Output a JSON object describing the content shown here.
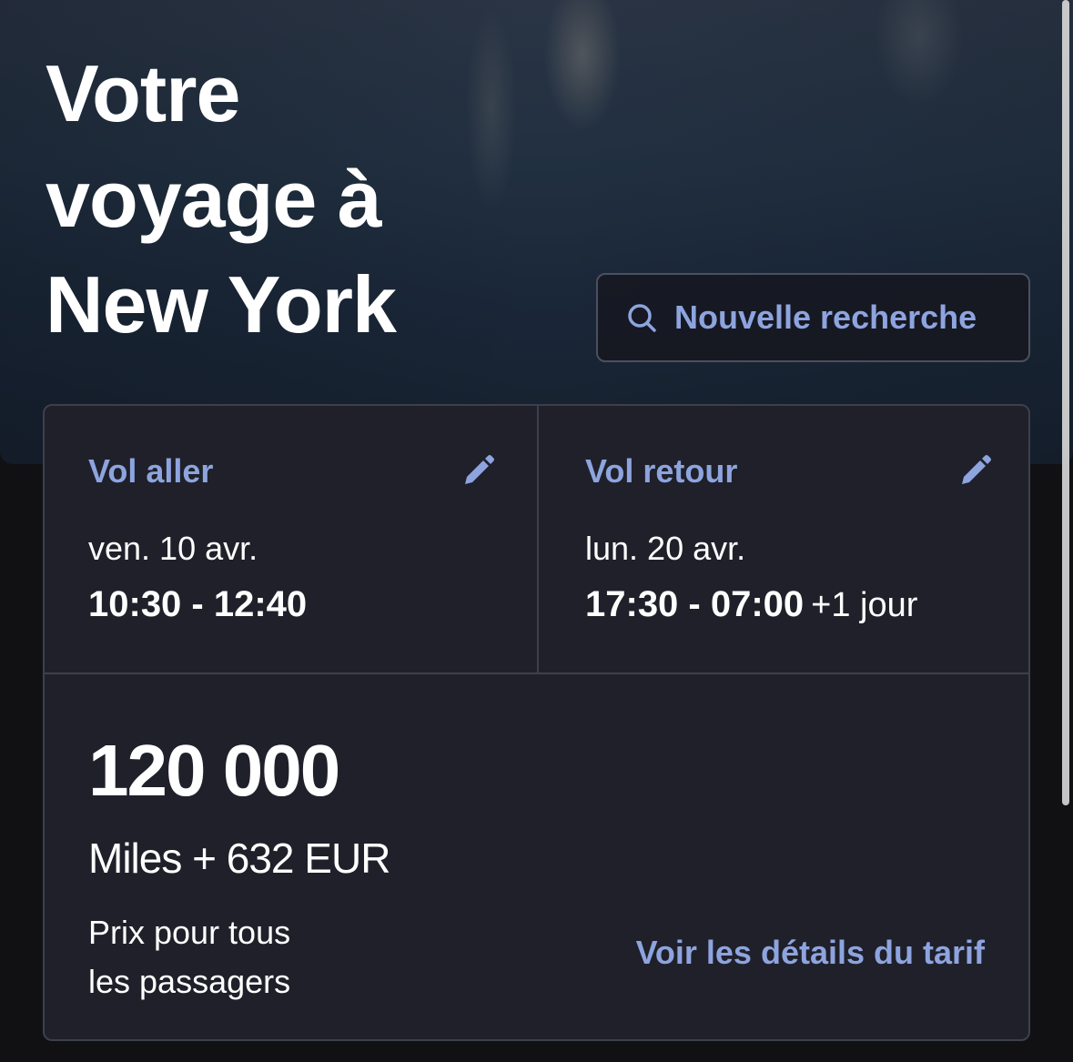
{
  "hero": {
    "title_line1": "Votre",
    "title_line2": "voyage à",
    "title_line3": "New York"
  },
  "search": {
    "label": "Nouvelle recherche",
    "icon": "search-icon"
  },
  "outbound": {
    "label": "Vol aller",
    "date": "ven. 10 avr.",
    "times": "10:30 - 12:40",
    "icon": "pencil-icon"
  },
  "return": {
    "label": "Vol retour",
    "date": "lun. 20 avr.",
    "times": "17:30 - 07:00",
    "extra": "+1 jour",
    "icon": "pencil-icon"
  },
  "price": {
    "miles_amount": "120 000",
    "miles_plus_cash": "Miles + 632 EUR",
    "note_line1": "Prix pour tous",
    "note_line2": "les passagers",
    "details_link": "Voir les détails du tarif"
  },
  "colors": {
    "accent": "#8ea4df",
    "card_bg": "#1f2029",
    "border": "#3d404c",
    "page_bg": "#111114"
  }
}
